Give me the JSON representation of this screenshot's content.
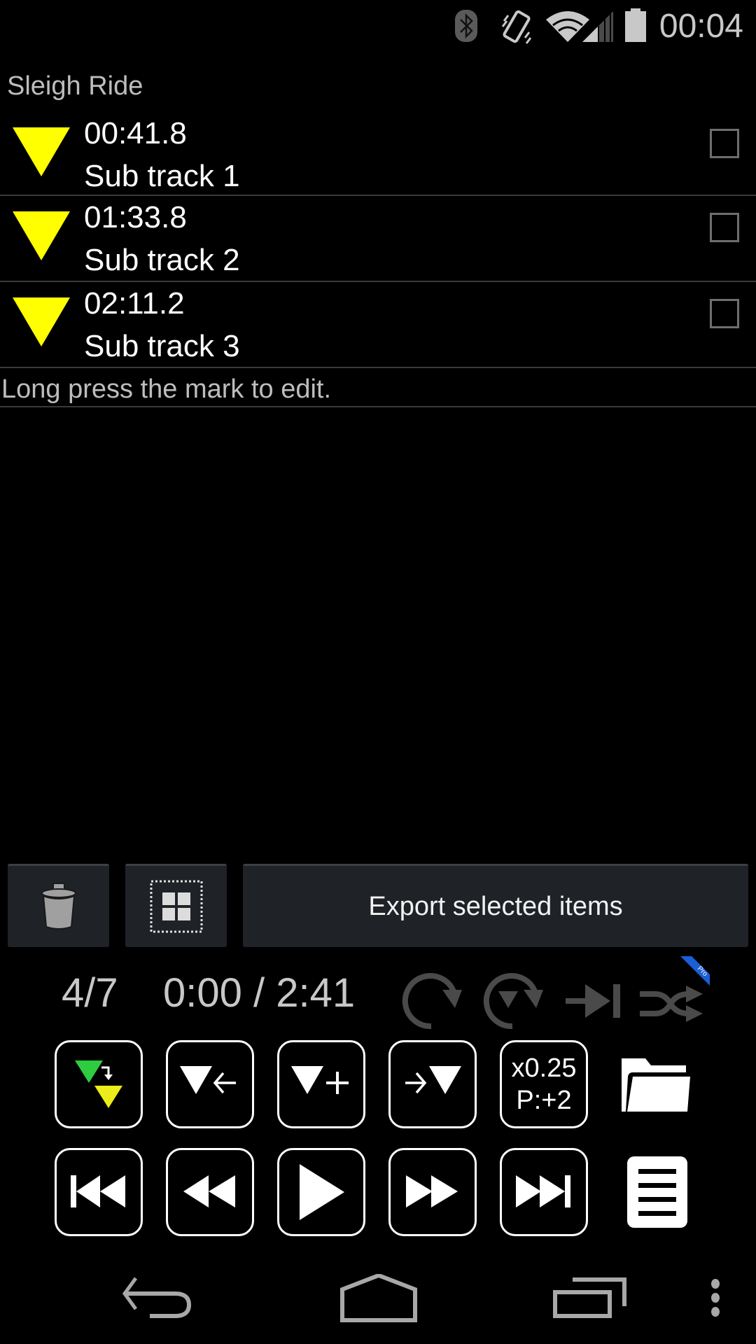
{
  "status_bar": {
    "icons": [
      "bluetooth-icon",
      "vibrate-icon",
      "wifi-icon",
      "cell-signal-icon",
      "battery-icon"
    ],
    "time": "00:04"
  },
  "song": {
    "title": "Sleigh Ride"
  },
  "marks": [
    {
      "time": "00:41.8",
      "name": "Sub track 1",
      "checked": false,
      "color": "#ffff00"
    },
    {
      "time": "01:33.8",
      "name": "Sub track 2",
      "checked": false,
      "color": "#ffff00"
    },
    {
      "time": "02:11.2",
      "name": "Sub track 3",
      "checked": false,
      "color": "#ffff00"
    }
  ],
  "hint": "Long press the mark to edit.",
  "actions": {
    "delete_icon": "trash-icon",
    "select_all_icon": "select-all-icon",
    "export_label": "Export selected items"
  },
  "player": {
    "track_position": "4/7",
    "time_display": "0:00 / 2:41",
    "mode_icons": [
      "repeat-icon",
      "repeat-mark-icon",
      "play-to-end-icon",
      "shuffle-icon"
    ],
    "pro_badge": "Pro",
    "speed": "x0.25",
    "pitch": "P:+2"
  },
  "controls": {
    "row1": [
      "mark-jump-icon",
      "mark-previous-icon",
      "add-mark-icon",
      "mark-next-icon",
      "speed-pitch",
      "folder-icon"
    ],
    "row2": [
      "skip-previous-icon",
      "rewind-icon",
      "play-icon",
      "fast-forward-icon",
      "skip-next-icon",
      "playlist-icon"
    ]
  },
  "colors": {
    "mark_yellow": "#ffff00",
    "mark_green": "#2ecc40",
    "pro_blue": "#1a5fd6",
    "button_bg": "#1f2227"
  },
  "navbar": [
    "back-icon",
    "home-icon",
    "recents-icon",
    "overflow-menu-icon"
  ]
}
